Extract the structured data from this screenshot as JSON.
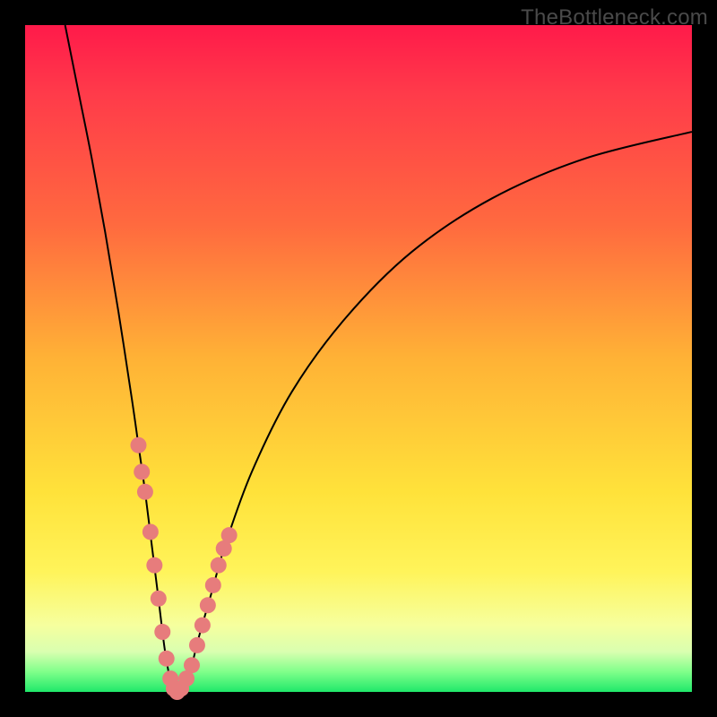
{
  "watermark": "TheBottleneck.com",
  "colors": {
    "gradient_top": "#ff1a4a",
    "gradient_mid": "#ffe23a",
    "gradient_bottom": "#20e86a",
    "marker": "#e77c7c",
    "curve": "#000000",
    "frame": "#000000"
  },
  "chart_data": {
    "type": "line",
    "title": "",
    "xlabel": "",
    "ylabel": "",
    "xlim": [
      0,
      100
    ],
    "ylim": [
      0,
      100
    ],
    "grid": false,
    "legend": false,
    "series": [
      {
        "name": "bottleneck-curve",
        "x": [
          6,
          8,
          10,
          12,
          14,
          16,
          17,
          18,
          19,
          20,
          21,
          22,
          23,
          24,
          25,
          26,
          28,
          30,
          34,
          40,
          48,
          58,
          70,
          84,
          100
        ],
        "y": [
          100,
          90,
          80,
          69,
          57,
          44,
          37,
          30,
          22,
          14,
          6,
          1,
          0,
          1,
          4,
          8,
          15,
          22,
          33,
          45,
          56,
          66,
          74,
          80,
          84
        ]
      }
    ],
    "markers": {
      "name": "highlight-points",
      "x": [
        17.0,
        17.5,
        18.0,
        18.8,
        19.4,
        20.0,
        20.6,
        21.2,
        21.8,
        22.3,
        22.8,
        23.4,
        24.2,
        25.0,
        25.8,
        26.6,
        27.4,
        28.2,
        29.0,
        29.8,
        30.6
      ],
      "y": [
        37,
        33,
        30,
        24,
        19,
        14,
        9,
        5,
        2,
        0.5,
        0,
        0.5,
        2,
        4,
        7,
        10,
        13,
        16,
        19,
        21.5,
        23.5
      ]
    }
  }
}
